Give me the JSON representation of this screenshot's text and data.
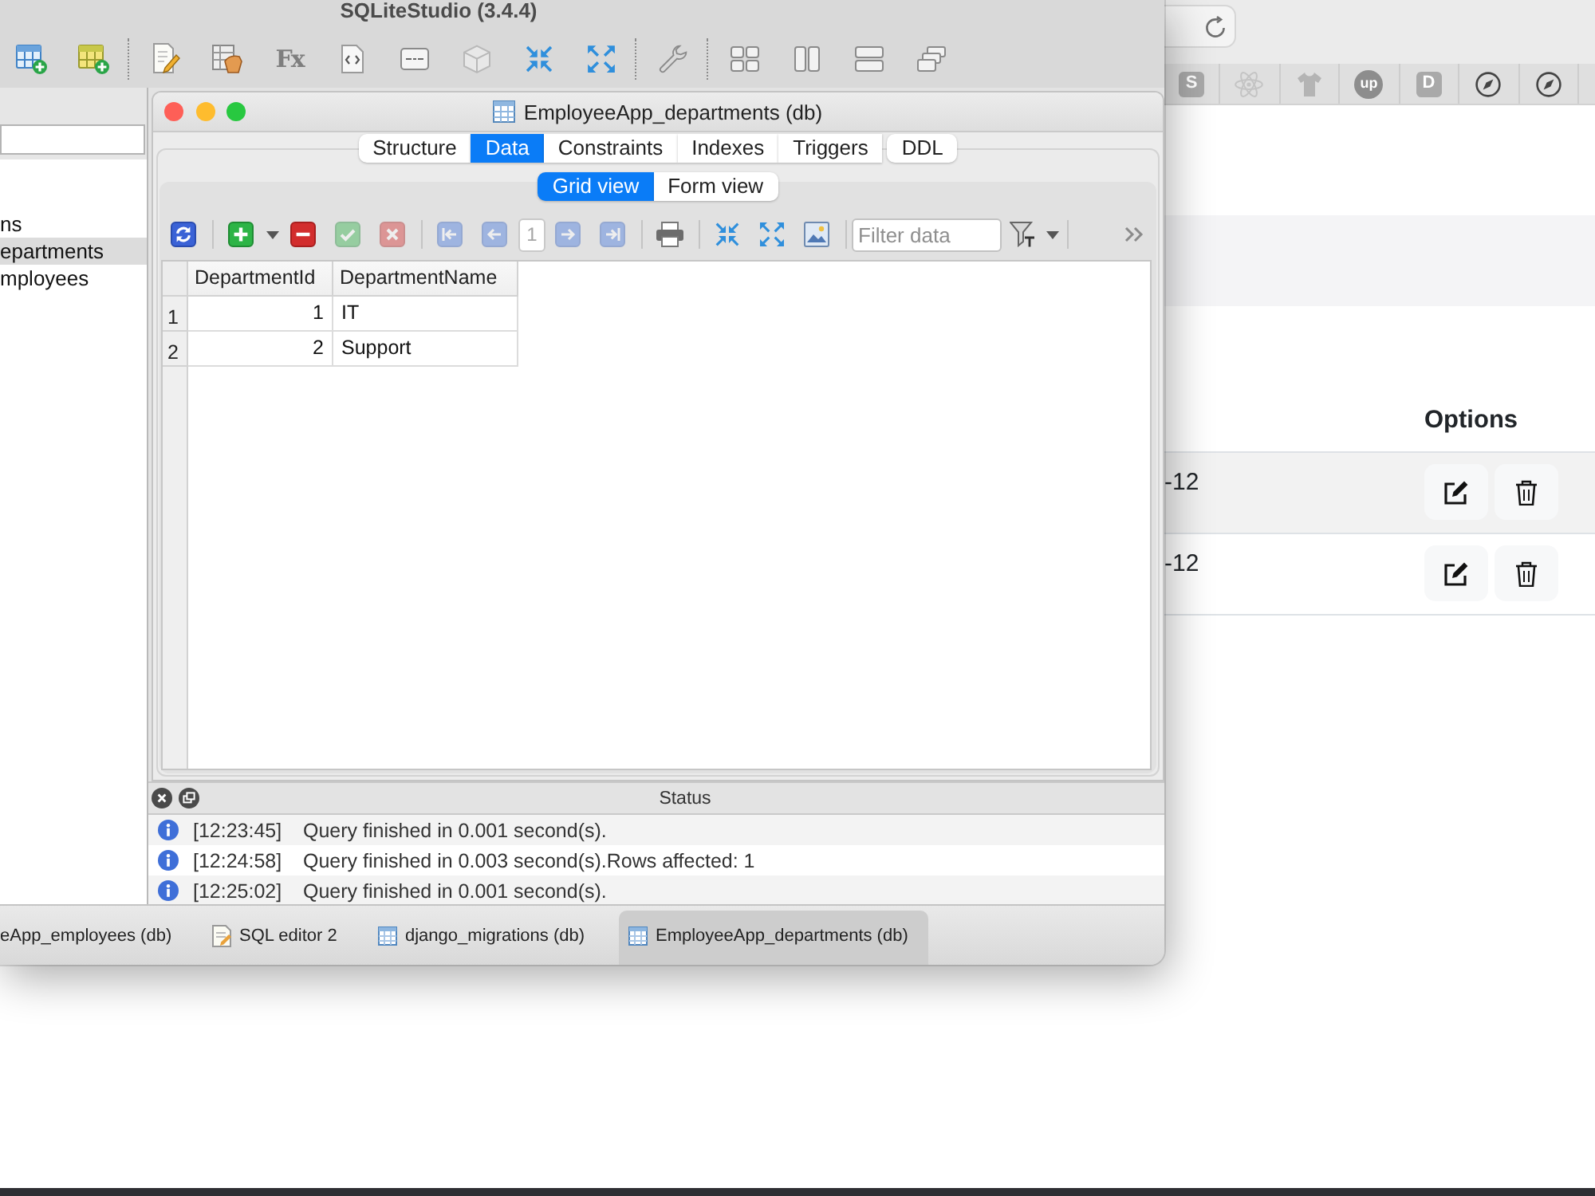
{
  "app_window": {
    "title": "SQLiteStudio (3.4.4)",
    "toolbar": [
      [
        {
          "kind": "table-add"
        },
        {
          "kind": "table-edit"
        }
      ],
      [
        {
          "kind": "document-edit"
        },
        {
          "kind": "table-hand"
        },
        {
          "kind": "function",
          "text": "Fx"
        },
        {
          "kind": "code-document"
        },
        {
          "kind": "card"
        },
        {
          "kind": "cube"
        },
        {
          "kind": "arrows-inward"
        },
        {
          "kind": "arrows-outward"
        }
      ],
      [
        {
          "kind": "wrench"
        }
      ],
      [
        {
          "kind": "tile-grid"
        },
        {
          "kind": "columns"
        },
        {
          "kind": "rows"
        },
        {
          "kind": "cascade"
        }
      ]
    ]
  },
  "database_tree": {
    "items": [
      {
        "label": "ns",
        "selected": false
      },
      {
        "label": "epartments",
        "selected": true
      },
      {
        "label": "mployees",
        "selected": false
      }
    ]
  },
  "table_window": {
    "title": "EmployeeApp_departments (db)",
    "tabs": [
      {
        "label": "Structure",
        "selected": false
      },
      {
        "label": "Data",
        "selected": true
      },
      {
        "label": "Constraints",
        "selected": false
      },
      {
        "label": "Indexes",
        "selected": false
      },
      {
        "label": "Triggers",
        "selected": false
      },
      {
        "label": "DDL",
        "selected": false
      }
    ],
    "views": [
      {
        "label": "Grid view",
        "selected": true
      },
      {
        "label": "Form view",
        "selected": false
      }
    ],
    "toolbar": [
      [
        {
          "kind": "refresh",
          "disabled": false
        }
      ],
      [
        {
          "kind": "add-row",
          "disabled": false
        },
        {
          "kind": "menu-caret",
          "disabled": false
        },
        {
          "kind": "delete-row",
          "disabled": false
        },
        {
          "kind": "commit",
          "disabled": true
        },
        {
          "kind": "rollback",
          "disabled": true
        }
      ],
      [
        {
          "kind": "first-page",
          "disabled": true
        },
        {
          "kind": "previous-page",
          "disabled": true
        },
        {
          "kind": "page-field",
          "value": "1",
          "disabled": true
        },
        {
          "kind": "next-page",
          "disabled": true
        },
        {
          "kind": "last-page",
          "disabled": true
        }
      ],
      [
        {
          "kind": "print",
          "disabled": false
        }
      ],
      [
        {
          "kind": "arrows-inward",
          "disabled": false
        },
        {
          "kind": "arrows-outward",
          "disabled": false
        },
        {
          "kind": "image-export",
          "disabled": false
        }
      ],
      [
        {
          "kind": "filter-field",
          "placeholder": "Filter data",
          "disabled": false
        },
        {
          "kind": "filter-mode",
          "disabled": false
        },
        {
          "kind": "menu-caret",
          "disabled": false
        }
      ]
    ],
    "grid": {
      "columns": [
        {
          "label": "DepartmentId",
          "kind": "number"
        },
        {
          "label": "DepartmentName",
          "kind": "text"
        }
      ],
      "rows": [
        {
          "number": "1",
          "cells": [
            "1",
            "IT"
          ]
        },
        {
          "number": "2",
          "cells": [
            "2",
            "Support"
          ]
        }
      ]
    }
  },
  "status_panel": {
    "title": "Status",
    "messages": [
      {
        "time": "[12:23:45]",
        "text": "Query finished in 0.001 second(s)."
      },
      {
        "time": "[12:24:58]",
        "text": "Query finished in 0.003 second(s).Rows affected: 1"
      },
      {
        "time": "[12:25:02]",
        "text": "Query finished in 0.001 second(s)."
      }
    ]
  },
  "task_bar": {
    "tabs": [
      {
        "label": "eApp_employees (db)",
        "kind": "plain",
        "selected": false
      },
      {
        "label": "SQL editor 2",
        "kind": "sql-editor",
        "selected": false
      },
      {
        "label": "django_migrations (db)",
        "kind": "table",
        "selected": false
      },
      {
        "label": "EmployeeApp_departments (db)",
        "kind": "table",
        "selected": true
      }
    ]
  },
  "browser": {
    "pinned_tabs": [
      {
        "kind": "letter-tile",
        "text": "S"
      },
      {
        "kind": "atom"
      },
      {
        "kind": "shirt"
      },
      {
        "kind": "letter-circle",
        "text": "up"
      },
      {
        "kind": "letter-tile",
        "text": "D"
      },
      {
        "kind": "compass"
      },
      {
        "kind": "compass"
      }
    ],
    "table": {
      "options_heading": "Options",
      "rows": [
        {
          "column_1": "-12"
        },
        {
          "column_1": "-12"
        }
      ]
    }
  }
}
